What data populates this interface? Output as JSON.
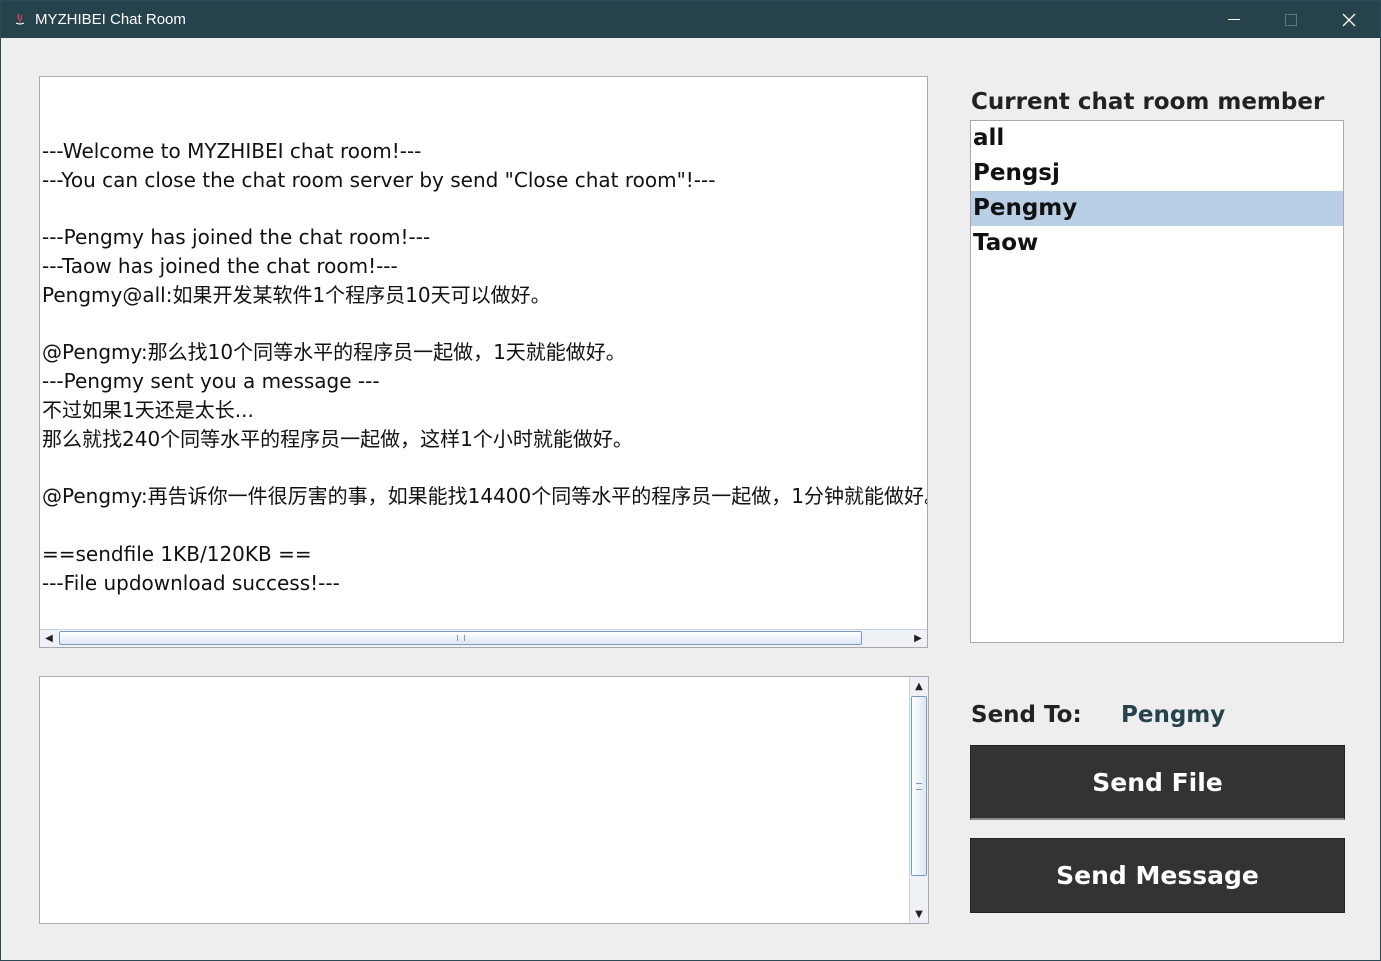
{
  "window": {
    "title": "MYZHIBEI Chat Room",
    "colors": {
      "titlebar": "#26424c",
      "selection": "#b8cfe5",
      "button": "#333333"
    }
  },
  "chat_log": {
    "lines": [
      "",
      "---Welcome to MYZHIBEI chat room!---",
      "---You can close the chat room server by send \"Close chat room\"!---",
      "",
      "---Pengmy has joined the chat room!---",
      "---Taow has joined the chat room!---",
      "Pengmy@all:如果开发某软件1个程序员10天可以做好。",
      "",
      "@Pengmy:那么找10个同等水平的程序员一起做，1天就能做好。",
      "---Pengmy sent you a message ---",
      "不过如果1天还是太长...",
      "那么就找240个同等水平的程序员一起做，这样1个小时就能做好。",
      "",
      "@Pengmy:再告诉你一件很厉害的事，如果能找14400个同等水平的程序员一起做，1分钟就能做好。",
      "",
      "==sendfile 1KB/120KB ==",
      "---File updownload success!---"
    ]
  },
  "message_input": {
    "value": ""
  },
  "members": {
    "title": "Current chat room member",
    "items": [
      "all",
      "Pengsj",
      "Pengmy",
      "Taow"
    ],
    "selected": "Pengmy"
  },
  "send_to": {
    "label": "Send To:",
    "value": "Pengmy"
  },
  "buttons": {
    "send_file": "Send File",
    "send_message": "Send Message"
  }
}
